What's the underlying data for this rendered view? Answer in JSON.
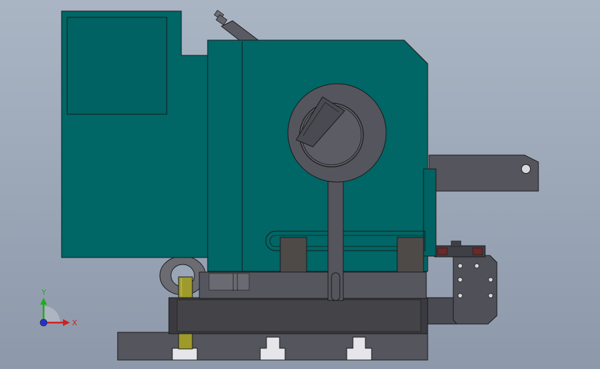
{
  "colors": {
    "teal_body": "#006666",
    "teal_dark": "#005959",
    "steel_gray": "#55555d",
    "steel_dark": "#3a3a40",
    "brass": "#9e9a2c",
    "axis_x": "#cc2222",
    "axis_y": "#22aa22",
    "axis_z": "#2233cc",
    "outline": "#1a1a1a"
  },
  "triad": {
    "x_label": "X",
    "y_label": "Y"
  },
  "icons": {
    "triad": "coordinate-axes-icon"
  }
}
